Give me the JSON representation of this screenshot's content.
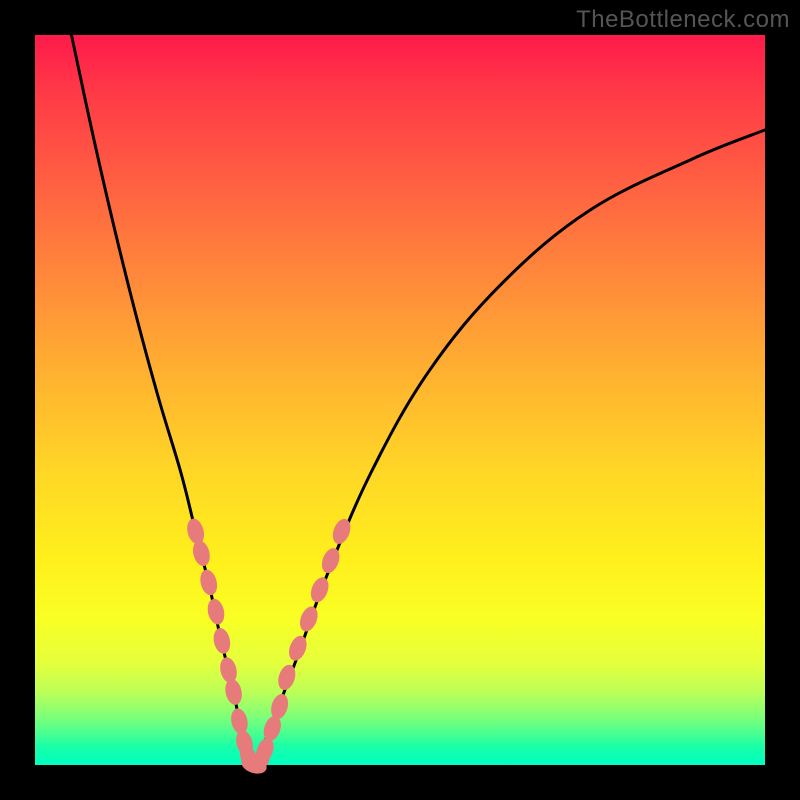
{
  "watermark": "TheBottleneck.com",
  "colors": {
    "background": "#000000",
    "gradient_top": "#ff1a4b",
    "gradient_bottom": "#00ffc0",
    "curve": "#000000",
    "marker": "#e77b7b"
  },
  "chart_data": {
    "type": "line",
    "title": "",
    "xlabel": "",
    "ylabel": "",
    "xlim": [
      0,
      100
    ],
    "ylim": [
      0,
      100
    ],
    "series": [
      {
        "name": "bottleneck-curve",
        "x": [
          5,
          8,
          11,
          14,
          17,
          20,
          22,
          24,
          25.5,
          27,
          28,
          29,
          30,
          31,
          33,
          36,
          40,
          46,
          54,
          64,
          76,
          90,
          100
        ],
        "y": [
          100,
          86,
          73,
          61,
          50,
          40,
          32,
          24,
          17,
          11,
          6,
          2,
          0,
          2,
          7,
          15,
          26,
          40,
          54,
          66,
          76,
          83,
          87
        ]
      }
    ],
    "markers": {
      "name": "highlighted-points",
      "shape": "ellipse",
      "points": [
        {
          "x": 22.0,
          "y": 32.0
        },
        {
          "x": 22.8,
          "y": 29.0
        },
        {
          "x": 23.8,
          "y": 25.0
        },
        {
          "x": 24.8,
          "y": 21.0
        },
        {
          "x": 25.6,
          "y": 17.0
        },
        {
          "x": 26.5,
          "y": 13.0
        },
        {
          "x": 27.2,
          "y": 10.0
        },
        {
          "x": 28.0,
          "y": 6.0
        },
        {
          "x": 28.7,
          "y": 3.0
        },
        {
          "x": 29.3,
          "y": 1.0
        },
        {
          "x": 30.0,
          "y": 0.0
        },
        {
          "x": 30.8,
          "y": 0.5
        },
        {
          "x": 31.5,
          "y": 2.0
        },
        {
          "x": 32.5,
          "y": 5.0
        },
        {
          "x": 33.5,
          "y": 8.0
        },
        {
          "x": 34.5,
          "y": 12.0
        },
        {
          "x": 36.0,
          "y": 16.0
        },
        {
          "x": 37.5,
          "y": 20.0
        },
        {
          "x": 39.0,
          "y": 24.0
        },
        {
          "x": 40.5,
          "y": 28.0
        },
        {
          "x": 42.0,
          "y": 32.0
        }
      ]
    }
  }
}
